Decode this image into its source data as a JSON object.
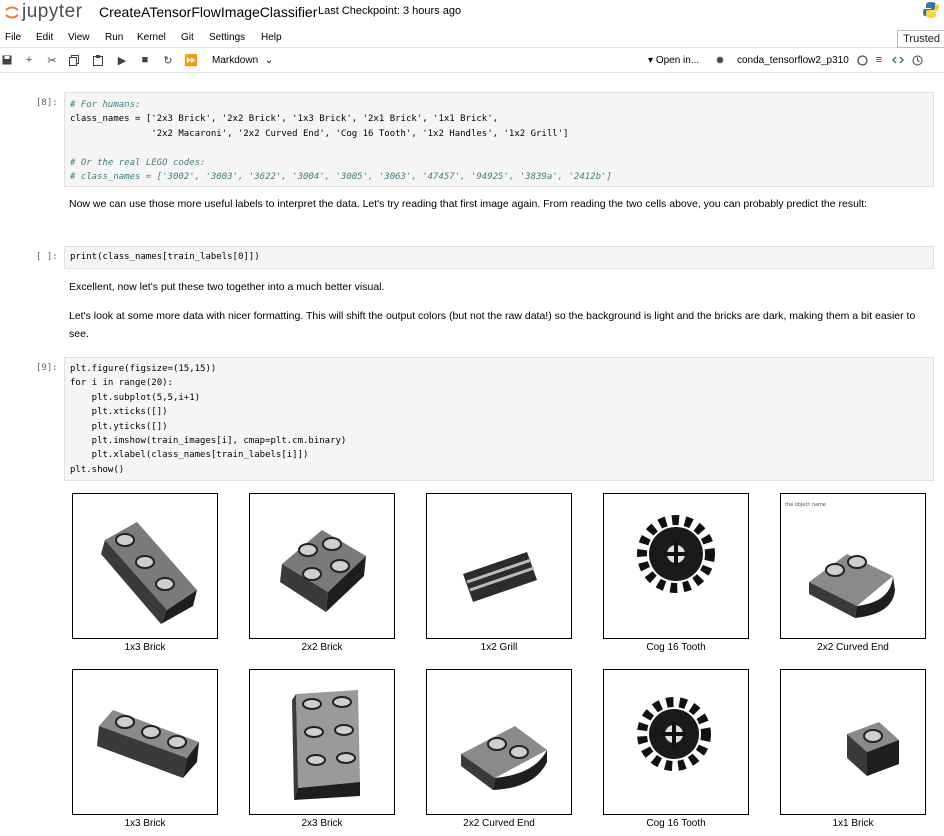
{
  "header": {
    "logo_text": "jupyter",
    "notebook_title": "CreateATensorFlowImageClassifier",
    "checkpoint": "Last Checkpoint: 3 hours ago"
  },
  "menu": [
    "File",
    "Edit",
    "View",
    "Run",
    "Kernel",
    "Git",
    "Settings",
    "Help"
  ],
  "trusted_label": "Trusted",
  "toolbar": {
    "cell_type": "Markdown",
    "open_in": "Open in...",
    "kernel": "conda_tensorflow2_p310"
  },
  "cells": {
    "c1_prompt": "[8]:",
    "c1_lines": [
      "# For humans:",
      "class_names = ['2x3 Brick', '2x2 Brick', '1x3 Brick', '2x1 Brick', '1x1 Brick',",
      "               '2x2 Macaroni', '2x2 Curved End', 'Cog 16 Tooth', '1x2 Handles', '1x2 Grill']",
      "",
      "# Or the real LEGO codes:",
      "# class_names = ['3002', '3003', '3622', '3004', '3005', '3063', '47457', '94925', '3839a', '2412b']"
    ],
    "md1": "Now we can use those more useful labels to interpret the data. Let's try reading that first image again. From reading the two cells above, you can probably predict the result:",
    "c2_prompt": "[ ]:",
    "c2_line": "print(class_names[train_labels[0]])",
    "md2": "Excellent, now let's put these two together into a much better visual.",
    "md3": "Let's look at some more data with nicer formatting. This will shift the output colors (but not the raw data!) so the background is light and the bricks are dark, making them a bit easier to see.",
    "c3_prompt": "[9]:",
    "c3_lines": [
      "plt.figure(figsize=(15,15))",
      "for i in range(20):",
      "    plt.subplot(5,5,i+1)",
      "    plt.xticks([])",
      "    plt.yticks([])",
      "    plt.imshow(train_images[i], cmap=plt.cm.binary)",
      "    plt.xlabel(class_names[train_labels[i]])",
      "plt.show()"
    ]
  },
  "output": {
    "tile_caption": "the object name",
    "labels": [
      "1x3 Brick",
      "2x2 Brick",
      "1x2 Grill",
      "Cog 16 Tooth",
      "2x2 Curved End",
      "1x3 Brick",
      "2x3 Brick",
      "2x2 Curved End",
      "Cog 16 Tooth",
      "1x1 Brick"
    ]
  }
}
